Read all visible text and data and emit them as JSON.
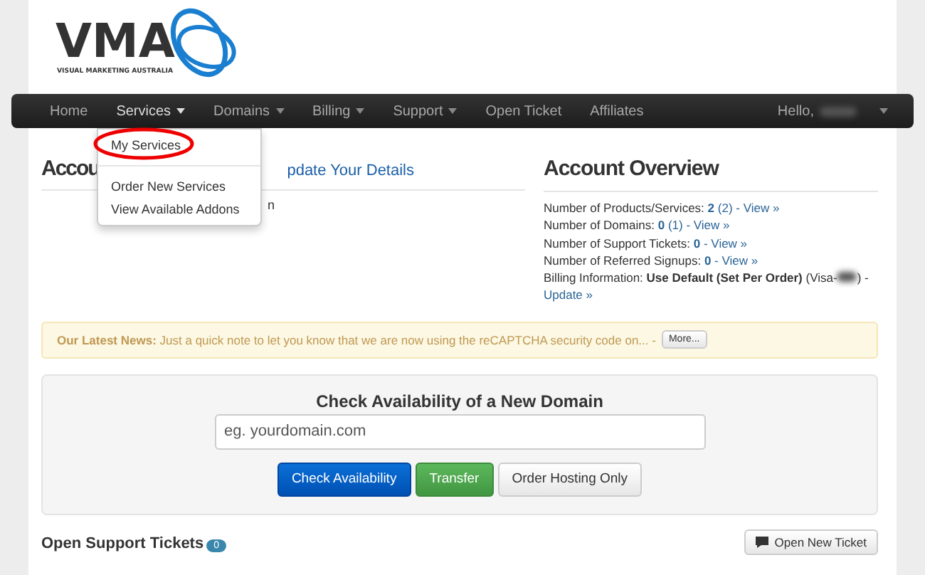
{
  "logo": {
    "wordmark": "VMA",
    "tagline": "VISUAL MARKETING AUSTRALIA"
  },
  "navbar": {
    "items": [
      {
        "label": "Home",
        "dropdown": false,
        "selected": false
      },
      {
        "label": "Services",
        "dropdown": true,
        "selected": true
      },
      {
        "label": "Domains",
        "dropdown": true,
        "selected": false
      },
      {
        "label": "Billing",
        "dropdown": true,
        "selected": false
      },
      {
        "label": "Support",
        "dropdown": true,
        "selected": false
      },
      {
        "label": "Open Ticket",
        "dropdown": false,
        "selected": false
      },
      {
        "label": "Affiliates",
        "dropdown": false,
        "selected": false
      }
    ],
    "user_greeting": "Hello,"
  },
  "services_menu": {
    "items": [
      {
        "label": "My Services",
        "circled": true
      },
      {
        "label": "Order New Services",
        "circled": false
      },
      {
        "label": "View Available Addons",
        "circled": false
      }
    ]
  },
  "account_panel": {
    "heading_visible": "Accou",
    "link_visible": "pdate Your Details",
    "line_fragment": "n"
  },
  "account_overview": {
    "heading": "Account Overview",
    "lines": [
      {
        "label": "Number of Products/Services:",
        "value": "2",
        "extra": "(2)",
        "link": "- View »"
      },
      {
        "label": "Number of Domains:",
        "value": "0",
        "extra": "(1)",
        "link": "- View »"
      },
      {
        "label": "Number of Support Tickets:",
        "value": "0",
        "link": "- View »"
      },
      {
        "label": "Number of Referred Signups:",
        "value": "0",
        "link": "- View »"
      }
    ],
    "billing": {
      "label": "Billing Information:",
      "value": "Use Default (Set Per Order)",
      "card_start": "(Visa-",
      "card_end": ") -",
      "link": "Update »"
    }
  },
  "news": {
    "label": "Our Latest News:",
    "text": "Just a quick note to let you know that we are now using the reCAPTCHA security code on... -",
    "button": "More..."
  },
  "domain_check": {
    "title": "Check Availability of a New Domain",
    "placeholder": "eg. yourdomain.com",
    "buttons": [
      {
        "label": "Check Availability",
        "kind": "primary"
      },
      {
        "label": "Transfer",
        "kind": "success"
      },
      {
        "label": "Order Hosting Only",
        "kind": "default"
      }
    ]
  },
  "support_tickets": {
    "title": "Open Support Tickets",
    "count": "0",
    "button": "Open New Ticket"
  }
}
